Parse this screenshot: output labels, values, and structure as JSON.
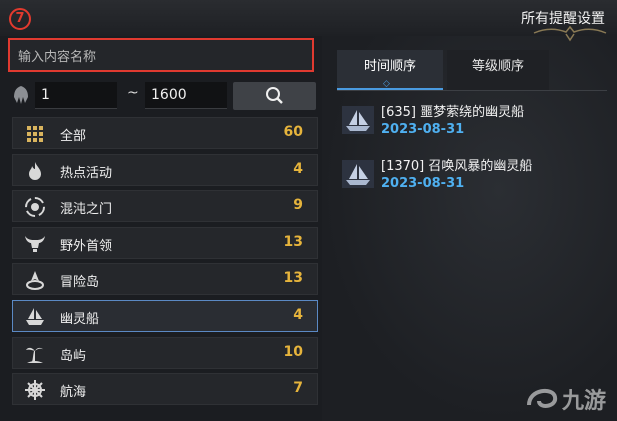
{
  "step_badge": "7",
  "window": {
    "title": "所有提醒设置"
  },
  "search": {
    "placeholder": "输入内容名称",
    "value": ""
  },
  "level_filter": {
    "min": "1",
    "separator": "~",
    "max": "1600"
  },
  "categories": [
    {
      "label": "全部",
      "count": "60",
      "icon": "grid-icon"
    },
    {
      "label": "热点活动",
      "count": "4",
      "icon": "flame-icon"
    },
    {
      "label": "混沌之门",
      "count": "9",
      "icon": "vortex-icon"
    },
    {
      "label": "野外首领",
      "count": "13",
      "icon": "horned-skull-icon"
    },
    {
      "label": "冒险岛",
      "count": "13",
      "icon": "island-compass-icon"
    },
    {
      "label": "幽灵船",
      "count": "4",
      "icon": "ghost-ship-icon"
    },
    {
      "label": "岛屿",
      "count": "10",
      "icon": "palm-island-icon"
    },
    {
      "label": "航海",
      "count": "7",
      "icon": "ship-wheel-icon"
    }
  ],
  "selected_category": "幽灵船",
  "tabs": [
    {
      "label": "时间顺序",
      "active": true
    },
    {
      "label": "等级顺序",
      "active": false
    }
  ],
  "notices": [
    {
      "title": "[635] 噩梦萦绕的幽灵船",
      "date": "2023-08-31"
    },
    {
      "title": "[1370] 召唤风暴的幽灵船",
      "date": "2023-08-31"
    }
  ],
  "watermark": "九游",
  "colors": {
    "accent_red": "#e03a30",
    "count_gold": "#e6b43c",
    "date_blue": "#4fb0f0",
    "selected_border": "#5b89c4"
  }
}
